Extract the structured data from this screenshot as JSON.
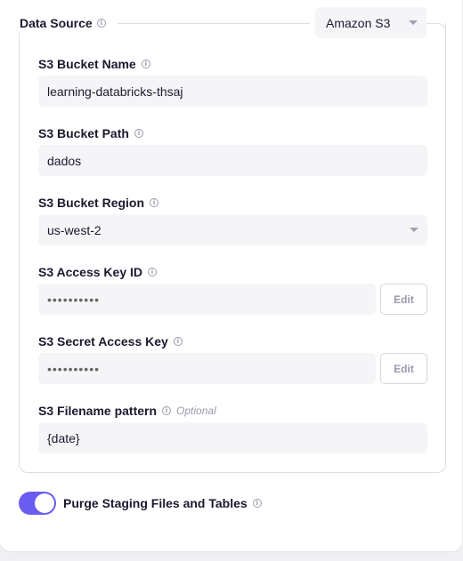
{
  "data_source": {
    "label": "Data Source",
    "selected": "Amazon S3"
  },
  "fields": {
    "bucket_name": {
      "label": "S3 Bucket Name",
      "value": "learning-databricks-thsaj"
    },
    "bucket_path": {
      "label": "S3 Bucket Path",
      "value": "dados"
    },
    "bucket_region": {
      "label": "S3 Bucket Region",
      "value": "us-west-2"
    },
    "access_key": {
      "label": "S3 Access Key ID",
      "value": "••••••••••",
      "edit_label": "Edit"
    },
    "secret_key": {
      "label": "S3 Secret Access Key",
      "value": "••••••••••",
      "edit_label": "Edit"
    },
    "filename_pattern": {
      "label": "S3 Filename pattern",
      "optional": "Optional",
      "value": "{date}"
    }
  },
  "purge_toggle": {
    "label": "Purge Staging Files and Tables",
    "enabled": true
  },
  "colors": {
    "accent": "#6b5cf0",
    "input_bg": "#f5f5f8",
    "border": "#dcdce4"
  },
  "icons": {
    "info": "info-icon",
    "caret": "chevron-down-icon"
  }
}
